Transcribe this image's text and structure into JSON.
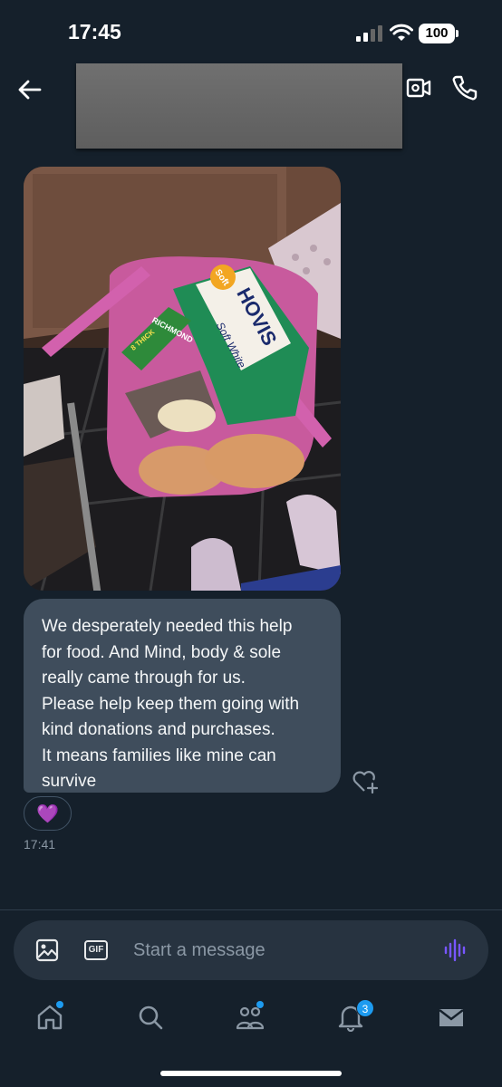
{
  "status_bar": {
    "time": "17:45",
    "battery": "100"
  },
  "conversation": {
    "messages": [
      {
        "type": "photo"
      },
      {
        "type": "text",
        "text": "We desperately needed this help\nfor food. And Mind, body & sole\nreally came through for us.\nPlease help keep them going with\nkind donations and purchases.\nIt means families like mine can\nsurvive"
      }
    ],
    "reaction": "💜",
    "timestamp": "17:41"
  },
  "photo_labels": {
    "bread_brand": "HOVIS",
    "bread_variant": "Soft White",
    "bread_flash": "Soft",
    "sausage_brand": "RICHMOND",
    "sausage_flash": "8 THICK"
  },
  "composer": {
    "placeholder": "Start a message",
    "gif_label": "GIF"
  },
  "nav": {
    "notifications_count": "3"
  },
  "colors": {
    "background": "#15202b",
    "bubble": "#3f4d5c",
    "accent": "#1d9bf0",
    "voice": "#7856ff"
  },
  "icons": [
    "back-arrow-icon",
    "video-camera-icon",
    "phone-icon",
    "heart-plus-icon",
    "image-icon",
    "gif-icon",
    "voice-wave-icon",
    "home-icon",
    "search-icon",
    "communities-icon",
    "bell-icon",
    "mail-icon"
  ]
}
